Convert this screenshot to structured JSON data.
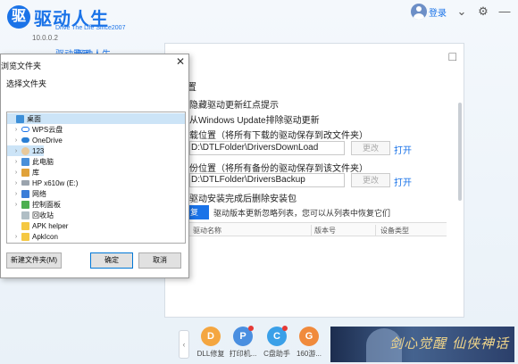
{
  "app": {
    "logo_mark": "驱",
    "title": "驱动人生",
    "subtitle": "Drive The Life  Since2007",
    "version": "10.0.0.2",
    "login": "登录",
    "nav_partial": [
      "驱动管理",
      "驱动人生"
    ]
  },
  "settings": {
    "close": "□",
    "section_title": "置",
    "row_hide_update": "隐藏驱动更新红点提示",
    "row_windows_update": "从Windows Update排除驱动更新",
    "download_label": "载位置（将所有下载的驱动保存到改文件夹）",
    "download_path": "D:\\DTLFolder\\DriversDownLoad",
    "backup_label": "份位置（将所有备份的驱动保存到该文件夹）",
    "backup_path": "D:\\DTLFolder\\DriversBackup",
    "change": "更改",
    "open": "打开",
    "row_delete_pkg": "驱动安装完成后删除安装包",
    "restore_btn": "复",
    "restore_note": "驱动版本更新忽略列表，您可以从列表中恢复它们",
    "table_headers": [
      "驱动名称",
      "版本号",
      "设备类型"
    ]
  },
  "bottom_tools": [
    {
      "label": "DLL修复",
      "icon": "dll-repair-icon",
      "color": "#f4a640"
    },
    {
      "label": "打印机...",
      "icon": "printer-icon",
      "color": "#4a8fe0"
    },
    {
      "label": "C盘助手",
      "icon": "c-drive-icon",
      "color": "#3aa0e8"
    },
    {
      "label": "160游...",
      "icon": "game-icon",
      "color": "#f08a3c"
    }
  ],
  "ad_text": "剑心觉醒 仙侠神话",
  "dialog": {
    "title": "浏览文件夹",
    "close": "✕",
    "prompt": "选择文件夹",
    "tree": [
      {
        "label": "桌面",
        "expander": "",
        "icon": "desktop",
        "indent": 0,
        "selected": true
      },
      {
        "label": "WPS云盘",
        "expander": "›",
        "icon": "cloud",
        "indent": 1,
        "selected": false
      },
      {
        "label": "OneDrive",
        "expander": "›",
        "icon": "onedrive",
        "indent": 1,
        "selected": false
      },
      {
        "label": "123",
        "expander": "›",
        "icon": "user",
        "indent": 1,
        "selected": true
      },
      {
        "label": "此电脑",
        "expander": "›",
        "icon": "pc",
        "indent": 1,
        "selected": false
      },
      {
        "label": "库",
        "expander": "›",
        "icon": "lib",
        "indent": 1,
        "selected": false
      },
      {
        "label": "HP x610w (E:)",
        "expander": "›",
        "icon": "drive",
        "indent": 1,
        "selected": false
      },
      {
        "label": "网络",
        "expander": "›",
        "icon": "net",
        "indent": 1,
        "selected": false
      },
      {
        "label": "控制面板",
        "expander": "›",
        "icon": "cpanel",
        "indent": 1,
        "selected": false
      },
      {
        "label": "回收站",
        "expander": "",
        "icon": "bin",
        "indent": 1,
        "selected": false
      },
      {
        "label": "APK helper",
        "expander": "",
        "icon": "folder",
        "indent": 1,
        "selected": false
      },
      {
        "label": "ApkIcon",
        "expander": "›",
        "icon": "folder",
        "indent": 1,
        "selected": false
      }
    ],
    "buttons": {
      "new_folder": "新建文件夹(M)",
      "ok": "确定",
      "cancel": "取消"
    }
  }
}
